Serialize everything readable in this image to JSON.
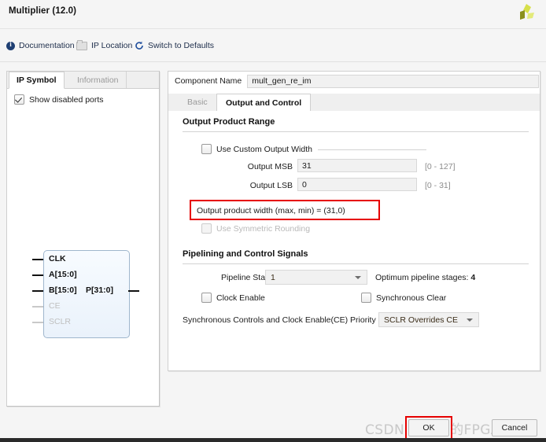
{
  "window": {
    "title": "Multiplier (12.0)",
    "logo_icon": "xilinx-leaf-logo"
  },
  "toolbar": {
    "items": [
      {
        "label": "Documentation",
        "icon": "info-icon"
      },
      {
        "label": "IP Location",
        "icon": "folder-icon"
      },
      {
        "label": "Switch to Defaults",
        "icon": "refresh-icon"
      }
    ]
  },
  "left_panel": {
    "tabs": [
      {
        "label": "IP Symbol",
        "active": true
      },
      {
        "label": "Information",
        "active": false
      }
    ],
    "show_disabled_ports": {
      "label": "Show disabled ports",
      "checked": true
    },
    "symbol": {
      "inputs": [
        {
          "name": "CLK",
          "enabled": true
        },
        {
          "name": "A[15:0]",
          "enabled": true
        },
        {
          "name": "B[15:0]",
          "enabled": true
        },
        {
          "name": "CE",
          "enabled": false
        },
        {
          "name": "SCLR",
          "enabled": false
        }
      ],
      "outputs": [
        {
          "name": "P[31:0]",
          "enabled": true
        }
      ]
    }
  },
  "right_panel": {
    "component_name": {
      "label": "Component Name",
      "value": "mult_gen_re_im"
    },
    "tabs": [
      {
        "label": "Basic",
        "active": false
      },
      {
        "label": "Output and Control",
        "active": true
      }
    ],
    "output_product_range": {
      "title": "Output Product Range",
      "use_custom_output_width": {
        "label": "Use Custom Output Width",
        "checked": false
      },
      "output_msb": {
        "label": "Output MSB",
        "value": "31",
        "range": "[0 - 127]"
      },
      "output_lsb": {
        "label": "Output LSB",
        "value": "0",
        "range": "[0 - 31]"
      },
      "product_width_text": "Output product width (max, min) = (31,0)",
      "use_symmetric_rounding": {
        "label": "Use Symmetric Rounding",
        "checked": false,
        "disabled": true
      }
    },
    "pipelining": {
      "title": "Pipelining and Control Signals",
      "pipeline_stages": {
        "label": "Pipeline Stages",
        "value": "1"
      },
      "optimum_label": "Optimum pipeline stages:",
      "optimum_value": "4",
      "clock_enable": {
        "label": "Clock Enable",
        "checked": false
      },
      "synchronous_clear": {
        "label": "Synchronous Clear",
        "checked": false
      },
      "priority": {
        "label": "Synchronous Controls and Clock Enable(CE) Priority",
        "value": "SCLR Overrides CE"
      }
    }
  },
  "footer": {
    "ok_label": "OK",
    "cancel_label": "Cancel"
  },
  "watermark": {
    "text": "CSDN @布丁的FPGA之旅"
  },
  "colors": {
    "highlight_red": "#e60000",
    "accent_blue": "#1f3f73",
    "logo_green": "#c3d22b"
  }
}
